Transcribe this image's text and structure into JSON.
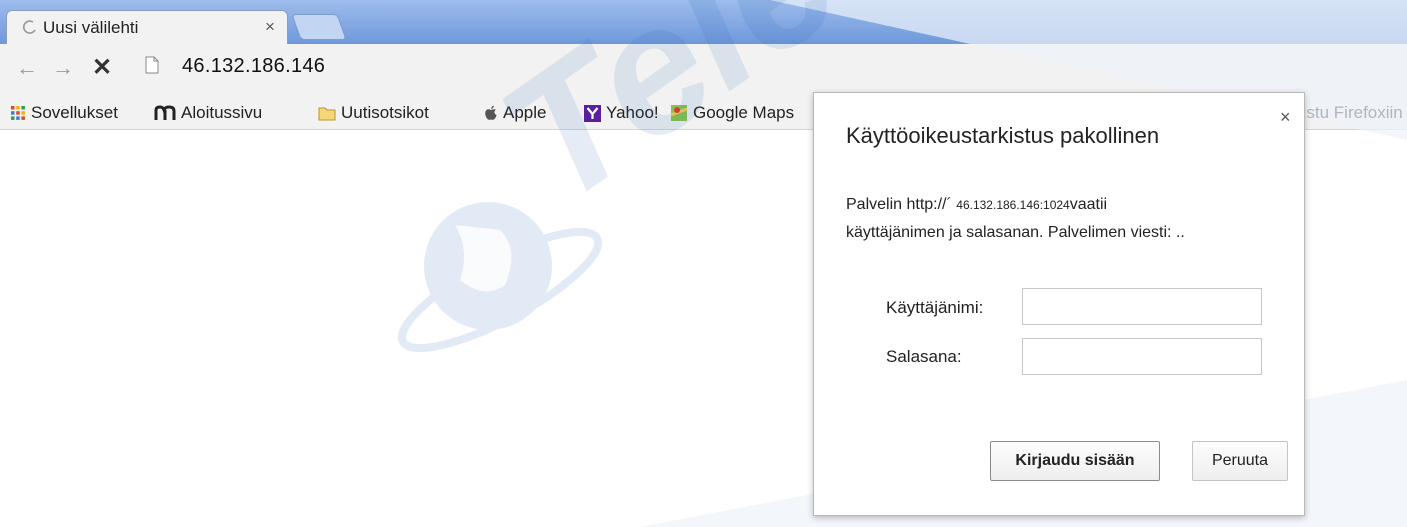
{
  "tab": {
    "title": "Uusi välilehti",
    "close": "×"
  },
  "toolbar": {
    "url": "46.132.186.146"
  },
  "bookmarks": [
    {
      "label": "Sovellukset",
      "icon": "apps-grid-icon"
    },
    {
      "label": "Aloitussivu",
      "icon": "m-logo-icon"
    },
    {
      "label": "Uutisotsikot",
      "icon": "folder-icon"
    },
    {
      "label": "Apple",
      "icon": "apple-icon"
    },
    {
      "label": "Yahoo!",
      "icon": "yahoo-icon"
    },
    {
      "label": "Google Maps",
      "icon": "maps-icon"
    },
    {
      "label": "Tutustu Firefoxiin",
      "icon": "firefox-icon"
    }
  ],
  "dialog": {
    "title": "Käyttöoikeustarkistus pakollinen",
    "close": "×",
    "message_prefix": "Palvelin http://´",
    "message_server": "46.132.186.146:1024",
    "message_line1_suffix": "vaatii",
    "message_line2": "käyttäjänimen ja salasanan. Palvelimen viesti: ..",
    "username_label": "Käyttäjänimi:",
    "password_label": "Salasana:",
    "username_value": "",
    "password_value": "",
    "login_button": "Kirjaudu sisään",
    "cancel_button": "Peruuta"
  },
  "watermark": {
    "text": "Telewo"
  },
  "colors": {
    "tabstrip": "#7ea4e0",
    "toolbar": "#f2f2f2",
    "watermark": "#1d5fb3"
  }
}
